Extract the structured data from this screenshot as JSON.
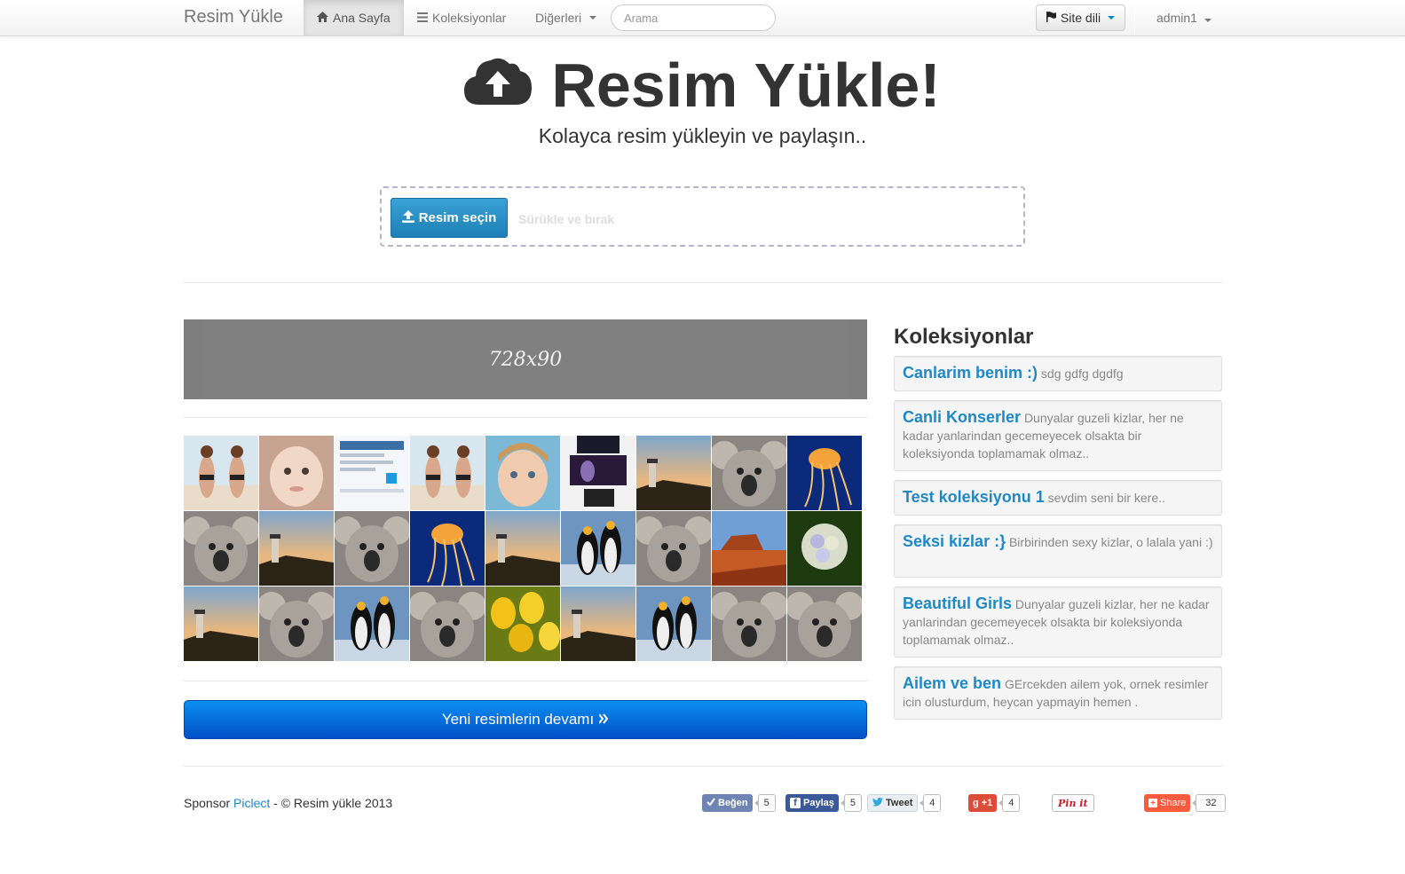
{
  "navbar": {
    "brand": "Resim Yükle",
    "home": "Ana Sayfa",
    "collections": "Koleksiyonlar",
    "others": "Diğerleri",
    "search_placeholder": "Arama",
    "language": "Site dili",
    "user": "admin1"
  },
  "hero": {
    "title": "Resim Yükle!",
    "subtitle": "Kolayca resim yükleyin ve paylaşın.."
  },
  "upload": {
    "button": "Resim seçin",
    "hint": "Sürükle ve bırak"
  },
  "ad": {
    "label": "728x90"
  },
  "thumbnails": [
    "bikini-girls",
    "baby-face",
    "screenshot",
    "bikini-girls",
    "toddler",
    "concert",
    "lighthouse",
    "koala",
    "jellyfish",
    "koala",
    "lighthouse",
    "koala",
    "jellyfish",
    "lighthouse",
    "penguins",
    "koala",
    "desert",
    "hydrangea",
    "lighthouse",
    "koala",
    "penguins",
    "koala",
    "tulips",
    "lighthouse",
    "penguins",
    "koala",
    "koala"
  ],
  "more_button": "Yeni resimlerin devamı",
  "sidebar": {
    "title": "Koleksiyonlar",
    "collections": [
      {
        "name": "Canlarim benim :)",
        "desc": "sdg gdfg dgdfg"
      },
      {
        "name": "Canli Konserler",
        "desc": "Dunyalar guzeli kizlar, her ne kadar yanlarindan gecemeyecek olsakta bir koleksiyonda toplamamak olmaz.."
      },
      {
        "name": "Test koleksiyonu 1",
        "desc": "sevdim seni bir kere.."
      },
      {
        "name": "Seksi kizlar :}",
        "desc": "Birbirinden sexy kizlar, o lalala yani :)"
      },
      {
        "name": "Beautiful Girls",
        "desc": "Dunyalar guzeli kizlar, her ne kadar yanlarindan gecemeyecek olsakta bir koleksiyonda toplamamak olmaz.."
      },
      {
        "name": "Ailem ve ben",
        "desc": "GErcekden ailem yok, ornek resimler icin olusturdum, heycan yapmayin hemen ."
      }
    ]
  },
  "footer": {
    "sponsor_prefix": "Sponsor",
    "sponsor_link": "Piclect",
    "copyright": "- © Resim yükle 2013"
  },
  "social": {
    "like": {
      "label": "Beğen",
      "count": "5",
      "color": "#6d84b4"
    },
    "fb_share": {
      "label": "Paylaş",
      "count": "5",
      "color": "#3b5998"
    },
    "tweet": {
      "label": "Tweet",
      "count": "4",
      "color": "#e8eef2"
    },
    "gplus": {
      "label": "+1",
      "count": "4",
      "color": "#dd4b39"
    },
    "pinit": {
      "label": "Pin it",
      "color": "#ffffff"
    },
    "share": {
      "label": "Share",
      "count": "32",
      "color": "#f65c3d"
    }
  }
}
